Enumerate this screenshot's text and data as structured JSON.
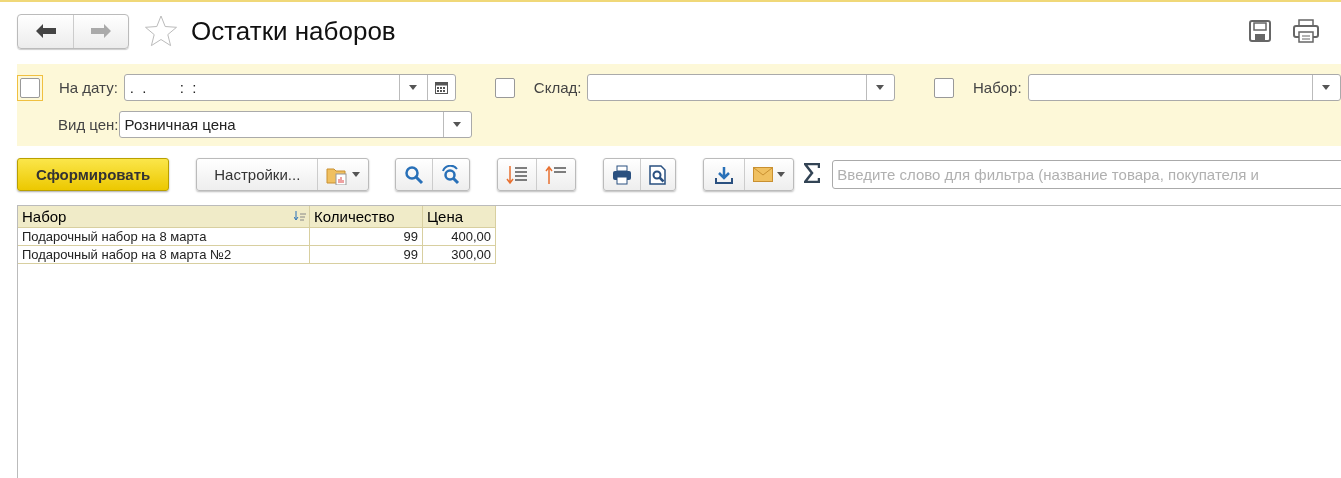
{
  "window": {
    "title": "Остатки наборов",
    "favorite": false
  },
  "filters": [
    {
      "kind": "date",
      "label": "На дату:",
      "checked": false,
      "focused": true,
      "value": ".  .        :  :"
    },
    {
      "kind": "select",
      "label": "Склад:",
      "checked": false,
      "focused": false
    },
    {
      "kind": "select",
      "label": "Набор:",
      "checked": false,
      "focused": false
    }
  ],
  "price_type": {
    "label": "Вид цен:",
    "value": "Розничная цена"
  },
  "toolbar": {
    "generate": "Сформировать",
    "settings": "Настройки...",
    "search_placeholder": "Введите слово для фильтра (название товара, покупателя и"
  },
  "table": {
    "columns": [
      {
        "label": "Набор",
        "sorted": true
      },
      {
        "label": "Количество",
        "sorted": false
      },
      {
        "label": "Цена",
        "sorted": false
      }
    ],
    "rows": [
      [
        "Подарочный набор на 8 марта",
        "99",
        "400,00"
      ],
      [
        "Подарочный набор на 8 марта №2",
        "99",
        "300,00"
      ]
    ]
  }
}
